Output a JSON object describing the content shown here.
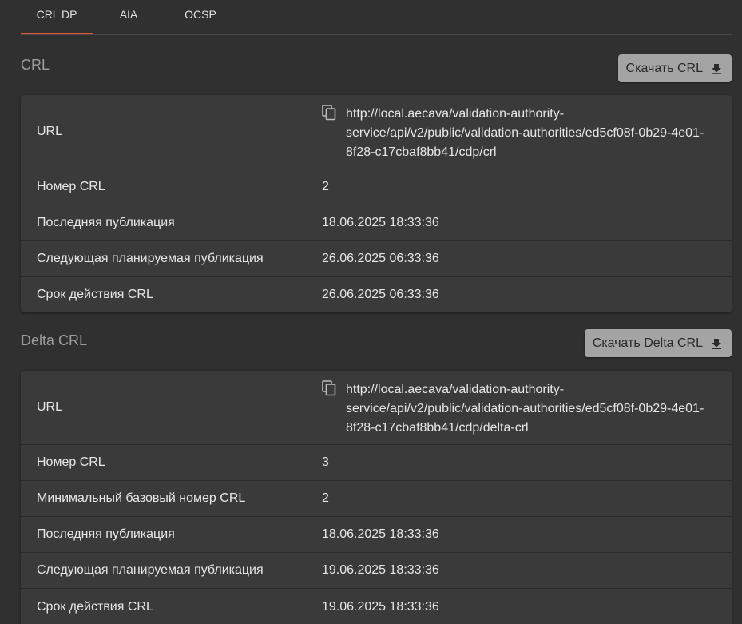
{
  "tabs": [
    {
      "label": "CRL DP",
      "active": true
    },
    {
      "label": "AIA",
      "active": false
    },
    {
      "label": "OCSP",
      "active": false
    }
  ],
  "crl": {
    "title": "CRL",
    "download_label": "Скачать CRL",
    "download_icon": "download-icon",
    "url_icon": "copy-icon",
    "url_lines": [
      "http://local.aecava/validation-authority-",
      "service/api/v2/public/validation-authorities/ed5cf08f-0b29-4e01-",
      "8f28-c17cbaf8bb41/cdp/crl"
    ],
    "rows": [
      {
        "label": "URL"
      },
      {
        "label": "Номер CRL",
        "value": "2"
      },
      {
        "label": "Последняя публикация",
        "value": "18.06.2025 18:33:36"
      },
      {
        "label": "Следующая планируемая публикация",
        "value": "26.06.2025 06:33:36"
      },
      {
        "label": "Срок действия CRL",
        "value": "26.06.2025 06:33:36"
      }
    ]
  },
  "delta_crl": {
    "title": "Delta CRL",
    "download_label": "Скачать Delta CRL",
    "download_icon": "download-icon",
    "url_icon": "copy-icon",
    "url_lines": [
      "http://local.aecava/validation-authority-",
      "service/api/v2/public/validation-authorities/ed5cf08f-0b29-4e01-",
      "8f28-c17cbaf8bb41/cdp/delta-crl"
    ],
    "rows": [
      {
        "label": "URL"
      },
      {
        "label": "Номер CRL",
        "value": "3"
      },
      {
        "label": "Минимальный базовый номер CRL",
        "value": "2"
      },
      {
        "label": "Последняя публикация",
        "value": "18.06.2025 18:33:36"
      },
      {
        "label": "Следующая планируемая публикация",
        "value": "19.06.2025 18:33:36"
      },
      {
        "label": "Срок действия CRL",
        "value": "19.06.2025 18:33:36"
      }
    ]
  },
  "colors": {
    "background": "#303030",
    "card": "#3a3a3a",
    "active_tab_indicator": "#e0533a",
    "button_bg": "#a4a4a4"
  }
}
